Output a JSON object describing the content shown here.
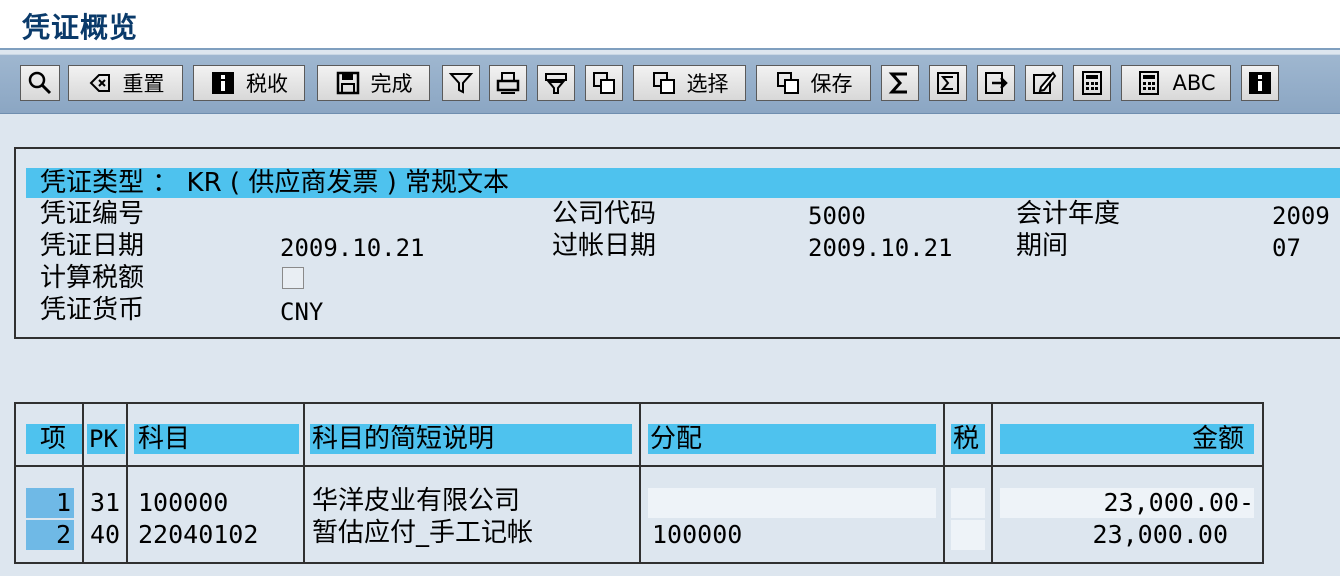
{
  "window": {
    "title": "凭证概览"
  },
  "toolbar": {
    "reset_label": "重置",
    "tax_label": "税收",
    "complete_label": "完成",
    "select_label": "选择",
    "save_label": "保存",
    "abc_label": "ABC"
  },
  "header": {
    "doc_type_line": "凭证类型 ： KR ( 供应商发票 ) 常规文本",
    "doc_number_label": "凭证编号",
    "doc_number_value": "",
    "company_code_label": "公司代码",
    "company_code_value": "5000",
    "fiscal_year_label": "会计年度",
    "fiscal_year_value": "2009",
    "doc_date_label": "凭证日期",
    "doc_date_value": "2009.10.21",
    "posting_date_label": "过帐日期",
    "posting_date_value": "2009.10.21",
    "period_label": "期间",
    "period_value": "07",
    "calc_tax_label": "计算税额",
    "calc_tax_checked": false,
    "currency_label": "凭证货币",
    "currency_value": "CNY"
  },
  "table": {
    "columns": {
      "item": "项",
      "pk": "PK",
      "account": "科目",
      "short_text": "科目的简短说明",
      "assignment": "分配",
      "tax": "税",
      "amount": "金额"
    },
    "rows": [
      {
        "item": "1",
        "pk": "31",
        "account": "100000",
        "short_text": "华洋皮业有限公司",
        "assignment": "",
        "tax": "",
        "amount": "23,000.00-"
      },
      {
        "item": "2",
        "pk": "40",
        "account": "22040102",
        "short_text": "暂估应付_手工记帐",
        "assignment": "100000",
        "tax": "",
        "amount": "23,000.00"
      }
    ]
  },
  "colors": {
    "background": "#dde6ef",
    "highlight": "#4ec2ee",
    "toolbar": "#8ba6c3",
    "title_text": "#0a3a6a"
  }
}
